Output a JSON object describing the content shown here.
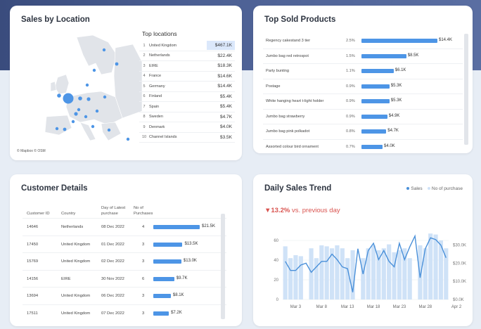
{
  "sales_by_location": {
    "title": "Sales by Location",
    "map_credit": "© Mapbox  © OSM",
    "top_locations_title": "Top locations",
    "locations": [
      {
        "rank": "1",
        "name": "United Kingdom",
        "value": "$467.1K",
        "highlight": true
      },
      {
        "rank": "2",
        "name": "Netherlands",
        "value": "$22.4K"
      },
      {
        "rank": "3",
        "name": "EIRE",
        "value": "$18.3K"
      },
      {
        "rank": "4",
        "name": "France",
        "value": "$14.6K"
      },
      {
        "rank": "5",
        "name": "Germany",
        "value": "$14.4K"
      },
      {
        "rank": "6",
        "name": "Finland",
        "value": "$5.4K"
      },
      {
        "rank": "7",
        "name": "Spain",
        "value": "$5.4K"
      },
      {
        "rank": "8",
        "name": "Sweden",
        "value": "$4.7K"
      },
      {
        "rank": "9",
        "name": "Denmark",
        "value": "$4.0K"
      },
      {
        "rank": "10",
        "name": "Channel Islands",
        "value": "$3.5K"
      }
    ]
  },
  "top_sold_products": {
    "title": "Top Sold Products",
    "products": [
      {
        "name": "Regency cakestand 3 tier",
        "pct": "2.5%",
        "value": "$14.4K",
        "amount": 14.4
      },
      {
        "name": "Jumbo bag red retrospot",
        "pct": "1.5%",
        "value": "$8.5K",
        "amount": 8.5
      },
      {
        "name": "Party bunting",
        "pct": "1.1%",
        "value": "$6.1K",
        "amount": 6.1
      },
      {
        "name": "Postage",
        "pct": "0.9%",
        "value": "$5.3K",
        "amount": 5.3
      },
      {
        "name": "White hanging heart t-light holder",
        "pct": "0.9%",
        "value": "$5.3K",
        "amount": 5.3
      },
      {
        "name": "Jumbo bag strawberry",
        "pct": "0.9%",
        "value": "$4.9K",
        "amount": 4.9
      },
      {
        "name": "Jumbo bag pink polkadot",
        "pct": "0.8%",
        "value": "$4.7K",
        "amount": 4.7
      },
      {
        "name": "Assorted colour bird ornament",
        "pct": "0.7%",
        "value": "$4.0K",
        "amount": 4.0
      }
    ]
  },
  "customer_details": {
    "title": "Customer Details",
    "headers": {
      "customer_id": "Customer ID",
      "country": "Country",
      "latest_purchase": "Day of Latest purchase",
      "purchases": "No of Purchases"
    },
    "rows": [
      {
        "id": "14646",
        "country": "Netherlands",
        "date": "08 Dec 2022",
        "purchases": "4",
        "value": "$21.5K",
        "amount": 21.5
      },
      {
        "id": "17450",
        "country": "United Kingdom",
        "date": "01 Dec 2022",
        "purchases": "3",
        "value": "$13.5K",
        "amount": 13.5
      },
      {
        "id": "15769",
        "country": "United Kingdom",
        "date": "02 Dec 2022",
        "purchases": "3",
        "value": "$13.0K",
        "amount": 13.0
      },
      {
        "id": "14156",
        "country": "EIRE",
        "date": "30 Nov 2022",
        "purchases": "6",
        "value": "$9.7K",
        "amount": 9.7
      },
      {
        "id": "13694",
        "country": "United Kingdom",
        "date": "06 Dec 2022",
        "purchases": "3",
        "value": "$8.1K",
        "amount": 8.1
      },
      {
        "id": "17511",
        "country": "United Kingdom",
        "date": "07 Dec 2022",
        "purchases": "3",
        "value": "$7.2K",
        "amount": 7.2
      }
    ]
  },
  "daily_sales_trend": {
    "title": "Daily Sales Trend",
    "delta": "▼13.2%",
    "delta_text": "vs. previous day",
    "legend_sales": "Sales",
    "legend_purchases": "No of purchase",
    "colors": {
      "sales_line": "#4a90d9",
      "purchase_bars": "#cfe2f7"
    }
  },
  "chart_data": {
    "type": "bar",
    "x": [
      "Mar 1",
      "Mar 2",
      "Mar 3",
      "Mar 4",
      "Mar 5",
      "Mar 6",
      "Mar 7",
      "Mar 8",
      "Mar 9",
      "Mar 10",
      "Mar 11",
      "Mar 12",
      "Mar 13",
      "Mar 14",
      "Mar 15",
      "Mar 16",
      "Mar 17",
      "Mar 18",
      "Mar 19",
      "Mar 20",
      "Mar 21",
      "Mar 22",
      "Mar 23",
      "Mar 24",
      "Mar 25",
      "Mar 26",
      "Mar 27",
      "Mar 28",
      "Mar 29",
      "Mar 30",
      "Mar 31",
      "Apr 1"
    ],
    "x_tick_labels": [
      "Mar 3",
      "Mar 8",
      "Mar 13",
      "Mar 18",
      "Mar 23",
      "Mar 28",
      "Apr 2"
    ],
    "series": [
      {
        "name": "No of purchase",
        "type": "bar",
        "axis": "left",
        "values": [
          54,
          42,
          45,
          44,
          0,
          52,
          42,
          55,
          54,
          52,
          55,
          52,
          42,
          50,
          0,
          42,
          52,
          55,
          50,
          52,
          56,
          48,
          50,
          52,
          42,
          0,
          55,
          52,
          67,
          66,
          60,
          52
        ]
      },
      {
        "name": "Sales",
        "type": "line",
        "axis": "right",
        "values": [
          21,
          16,
          16,
          19,
          20,
          15,
          18,
          21,
          21,
          25,
          22,
          18,
          17,
          4,
          28,
          14,
          27,
          31,
          22,
          27,
          21,
          18,
          31,
          22,
          29,
          35,
          12,
          28,
          34,
          33,
          30,
          23
        ]
      }
    ],
    "left_ticks": [
      "0",
      "20",
      "40",
      "60"
    ],
    "right_ticks": [
      "$0.0K",
      "$10.0K",
      "$20.0K",
      "$30.0K"
    ],
    "ylim_left": [
      0,
      70
    ],
    "ylim_right": [
      0,
      38
    ]
  }
}
